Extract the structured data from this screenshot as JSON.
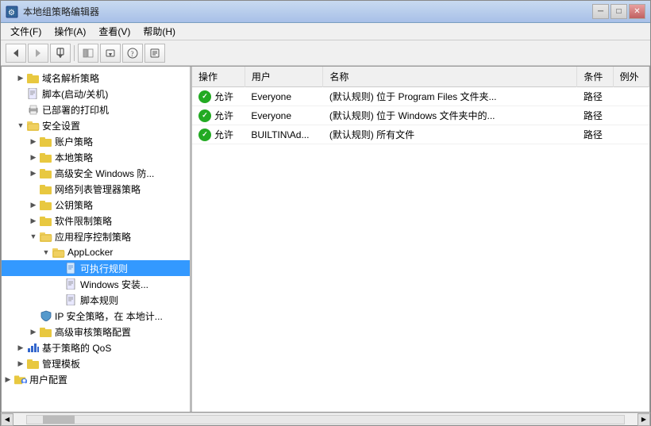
{
  "window": {
    "title": "本地组策略编辑器",
    "titlebar_icon": "⚙"
  },
  "titlebar_buttons": {
    "minimize": "─",
    "maximize": "□",
    "close": "✕"
  },
  "menubar": {
    "items": [
      {
        "id": "file",
        "label": "文件(F)"
      },
      {
        "id": "action",
        "label": "操作(A)"
      },
      {
        "id": "view",
        "label": "查看(V)"
      },
      {
        "id": "help",
        "label": "帮助(H)"
      }
    ]
  },
  "toolbar": {
    "buttons": [
      {
        "id": "back",
        "symbol": "◀",
        "label": "后退"
      },
      {
        "id": "forward",
        "symbol": "▶",
        "label": "前进"
      },
      {
        "id": "up",
        "symbol": "⬆",
        "label": "向上"
      },
      {
        "id": "show-hide",
        "symbol": "▤",
        "label": "显示/隐藏"
      },
      {
        "id": "export",
        "symbol": "⬇",
        "label": "导出"
      },
      {
        "id": "help",
        "symbol": "?",
        "label": "帮助"
      },
      {
        "id": "properties",
        "symbol": "⚙",
        "label": "属性"
      }
    ]
  },
  "tree": {
    "items": [
      {
        "id": "dns",
        "level": 1,
        "expanded": false,
        "label": "域名解析策略",
        "icon": "folder",
        "toggle": "▶"
      },
      {
        "id": "scripts",
        "level": 1,
        "expanded": false,
        "label": "脚本(启动/关机)",
        "icon": "page",
        "toggle": ""
      },
      {
        "id": "printers",
        "level": 1,
        "expanded": false,
        "label": "已部署的打印机",
        "icon": "page",
        "toggle": ""
      },
      {
        "id": "security",
        "level": 1,
        "expanded": true,
        "label": "安全设置",
        "icon": "folder-open",
        "toggle": "▼"
      },
      {
        "id": "account",
        "level": 2,
        "expanded": false,
        "label": "账户策略",
        "icon": "folder",
        "toggle": "▶"
      },
      {
        "id": "local",
        "level": 2,
        "expanded": false,
        "label": "本地策略",
        "icon": "folder",
        "toggle": "▶"
      },
      {
        "id": "firewall",
        "level": 2,
        "expanded": false,
        "label": "高级安全 Windows 防...",
        "icon": "folder",
        "toggle": "▶"
      },
      {
        "id": "netlist",
        "level": 2,
        "expanded": false,
        "label": "网络列表管理器策略",
        "icon": "folder",
        "toggle": ""
      },
      {
        "id": "pubkey",
        "level": 2,
        "expanded": false,
        "label": "公钥策略",
        "icon": "folder",
        "toggle": "▶"
      },
      {
        "id": "srp",
        "level": 2,
        "expanded": false,
        "label": "软件限制策略",
        "icon": "folder",
        "toggle": "▶"
      },
      {
        "id": "applocker-parent",
        "level": 2,
        "expanded": true,
        "label": "应用程序控制策略",
        "icon": "folder-open",
        "toggle": "▼"
      },
      {
        "id": "applocker",
        "level": 3,
        "expanded": true,
        "label": "AppLocker",
        "icon": "folder-open",
        "toggle": "▼"
      },
      {
        "id": "exe-rules",
        "level": 4,
        "expanded": false,
        "label": "可执行规则",
        "icon": "page",
        "toggle": "",
        "selected": true
      },
      {
        "id": "msi-rules",
        "level": 4,
        "expanded": false,
        "label": "Windows 安装...",
        "icon": "page",
        "toggle": ""
      },
      {
        "id": "script-rules",
        "level": 4,
        "expanded": false,
        "label": "脚本规则",
        "icon": "page",
        "toggle": ""
      },
      {
        "id": "ipsec",
        "level": 2,
        "expanded": false,
        "label": "IP 安全策略，在 本地计...",
        "icon": "shield",
        "toggle": ""
      },
      {
        "id": "audit",
        "level": 2,
        "expanded": false,
        "label": "高级审核策略配置",
        "icon": "folder",
        "toggle": "▶"
      },
      {
        "id": "qos",
        "level": 1,
        "expanded": false,
        "label": "基于策略的 QoS",
        "icon": "chart",
        "toggle": "▶"
      },
      {
        "id": "admtemplates",
        "level": 1,
        "expanded": false,
        "label": "管理模板",
        "icon": "folder",
        "toggle": "▶"
      },
      {
        "id": "userconfig",
        "level": 0,
        "expanded": false,
        "label": "用户配置",
        "icon": "user-folder",
        "toggle": "▶"
      }
    ]
  },
  "detail": {
    "columns": [
      {
        "id": "action",
        "label": "操作"
      },
      {
        "id": "user",
        "label": "用户"
      },
      {
        "id": "name",
        "label": "名称"
      },
      {
        "id": "condition",
        "label": "条件"
      },
      {
        "id": "exception",
        "label": "例外"
      }
    ],
    "rows": [
      {
        "status": "allow",
        "status_label": "✓",
        "action": "允许",
        "user": "Everyone",
        "name": "(默认规则) 位于 Program Files 文件夹...",
        "condition": "路径",
        "exception": ""
      },
      {
        "status": "allow",
        "status_label": "✓",
        "action": "允许",
        "user": "Everyone",
        "name": "(默认规则) 位于 Windows 文件夹中的...",
        "condition": "路径",
        "exception": ""
      },
      {
        "status": "allow",
        "status_label": "✓",
        "action": "允许",
        "user": "BUILTIN\\Ad...",
        "name": "(默认规则) 所有文件",
        "condition": "路径",
        "exception": ""
      }
    ]
  }
}
